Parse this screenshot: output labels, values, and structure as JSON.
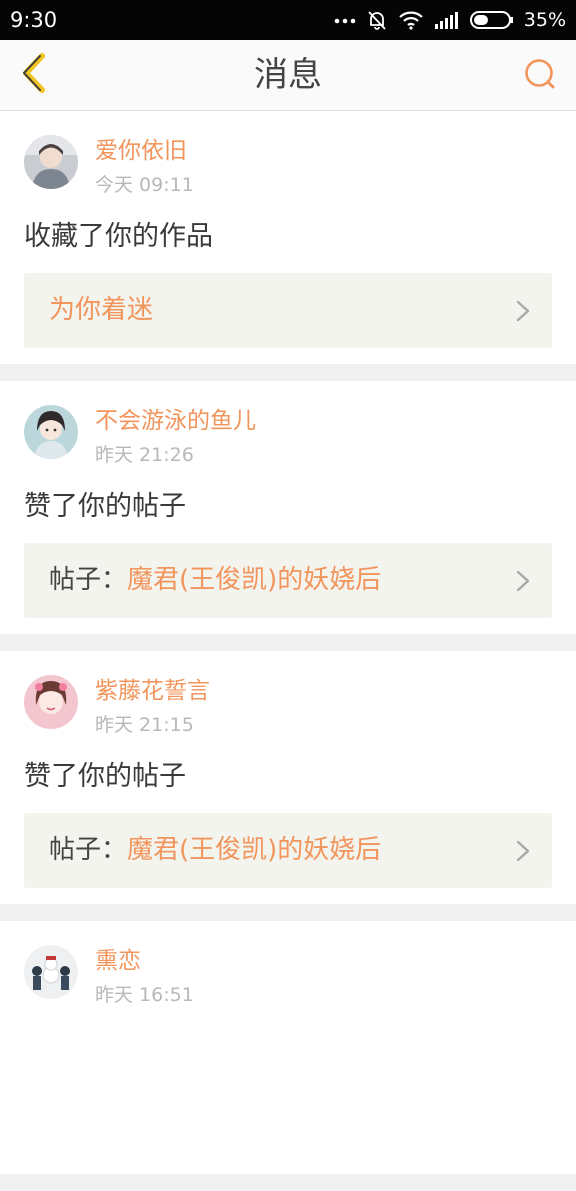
{
  "status_bar": {
    "time": "9:30",
    "battery": "35%",
    "icons": [
      "more-dots-icon",
      "mute-bell-icon",
      "wifi-icon",
      "signal-icon",
      "battery-icon"
    ]
  },
  "header": {
    "title": "消息",
    "back_icon": "back-chevron-icon",
    "search_icon": "search-icon",
    "accent_color": "#f2955c"
  },
  "messages": [
    {
      "username": "爱你依旧",
      "time": "今天 09:11",
      "action": "收藏了你的作品",
      "target_prefix": "",
      "target_title": "为你着迷"
    },
    {
      "username": "不会游泳的鱼儿",
      "time": "昨天 21:26",
      "action": "赞了你的帖子",
      "target_prefix": "帖子：",
      "target_title": "魔君(王俊凯)的妖娆后"
    },
    {
      "username": "紫藤花誓言",
      "time": "昨天 21:15",
      "action": "赞了你的帖子",
      "target_prefix": "帖子：",
      "target_title": "魔君(王俊凯)的妖娆后"
    },
    {
      "username": "熏恋",
      "time": "昨天 16:51",
      "action": "",
      "target_prefix": "",
      "target_title": ""
    }
  ]
}
